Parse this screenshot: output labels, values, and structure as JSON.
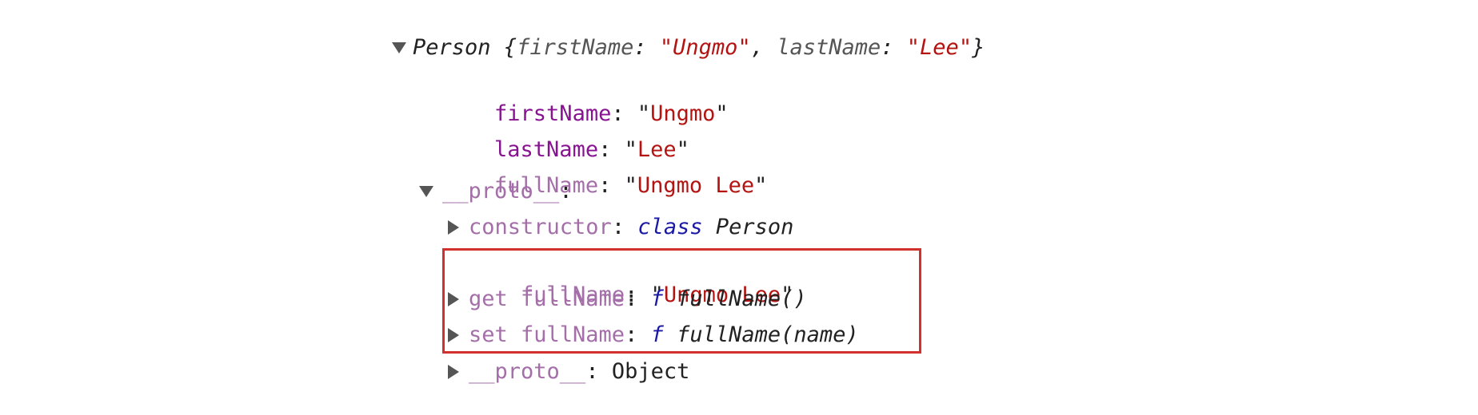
{
  "root": {
    "class_name": "Person",
    "open_brace": " {",
    "preview_key1": "firstName",
    "preview_val1": "Ungmo",
    "preview_key2": "lastName",
    "preview_val2": "Lee",
    "close_brace": "}"
  },
  "props": {
    "firstName_key": "firstName",
    "firstName_val": "Ungmo",
    "lastName_key": "lastName",
    "lastName_val": "Lee",
    "fullName_key": "fullName",
    "fullName_val": "Ungmo Lee"
  },
  "proto": {
    "key": "__proto__",
    "constructor_key": "constructor",
    "constructor_kw": "class",
    "constructor_name": "Person",
    "fullName_key": "fullName",
    "fullName_val": "Ungmo Lee",
    "getter_key": "get fullName",
    "getter_kw": "f",
    "getter_sig": "fullName()",
    "setter_key": "set fullName",
    "setter_kw": "f",
    "setter_sig": "fullName(name)",
    "inner_proto_key": "__proto__",
    "inner_proto_val": "Object"
  },
  "highlight_color": "#d0312d"
}
